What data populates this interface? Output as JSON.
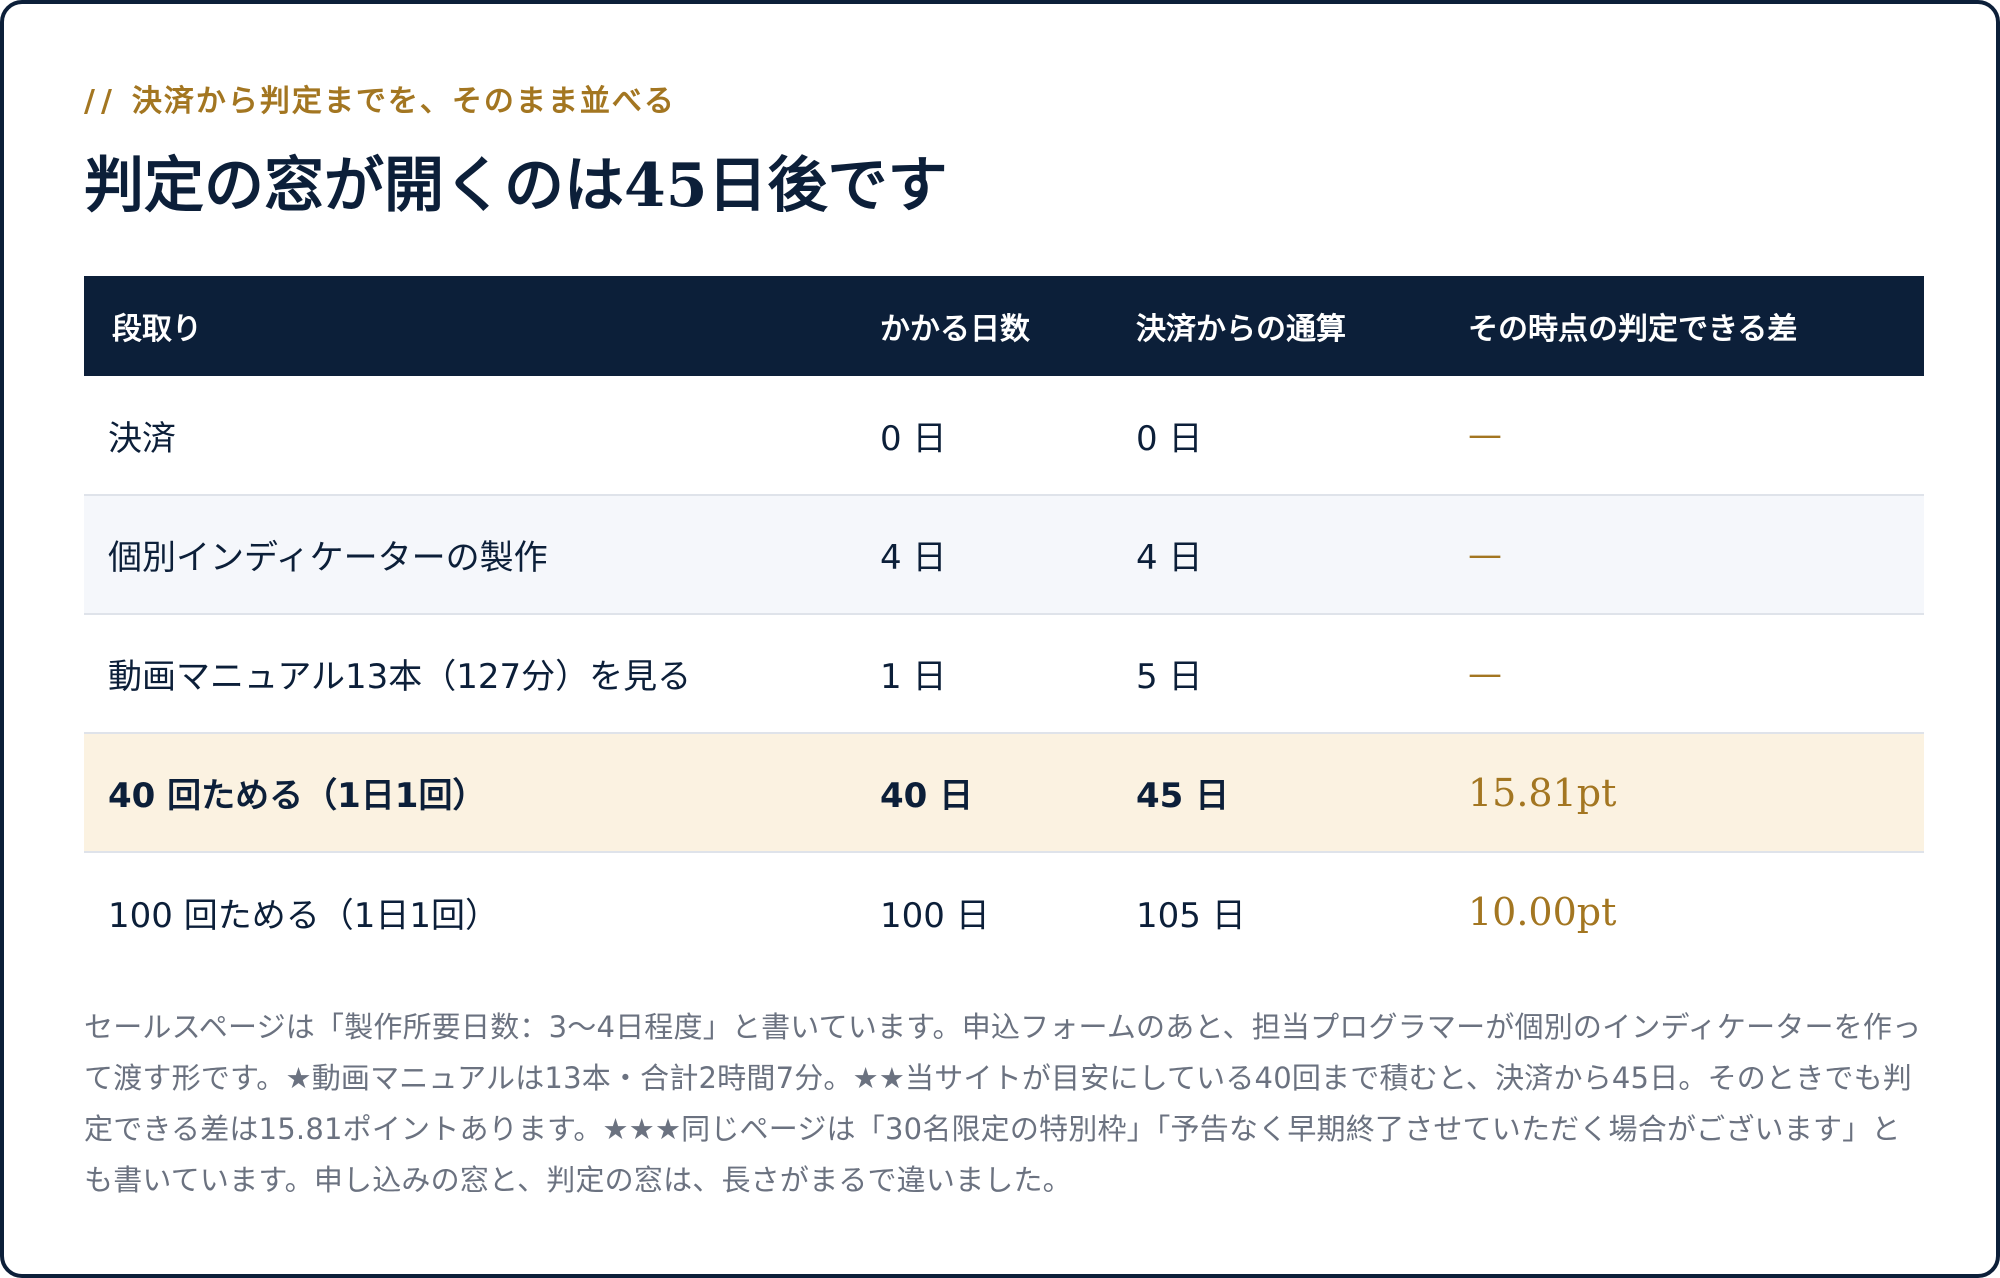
{
  "eyebrow": {
    "prefix": "//",
    "text": "決済から判定までを、そのまま並べる"
  },
  "title": "判定の窓が開くのは45日後です",
  "table": {
    "headers": [
      "段取り",
      "かかる日数",
      "決済からの通算",
      "その時点の判定できる差"
    ],
    "rows": [
      {
        "step": "決済",
        "days": "0 日",
        "cumulative": "0 日",
        "diff": "—"
      },
      {
        "step": "個別インディケーターの製作",
        "days": "4 日",
        "cumulative": "4 日",
        "diff": "—"
      },
      {
        "step": "動画マニュアル13本（127分）を見る",
        "days": "1 日",
        "cumulative": "5 日",
        "diff": "—"
      },
      {
        "step": "40 回ためる（1日1回）",
        "days": "40 日",
        "cumulative": "45 日",
        "diff": "15.81pt"
      },
      {
        "step": "100 回ためる（1日1回）",
        "days": "100 日",
        "cumulative": "105 日",
        "diff": "10.00pt"
      }
    ]
  },
  "note": "セールスページは「製作所要日数：3〜4日程度」と書いています。申込フォームのあと、担当プログラマーが個別のインディケーターを作って渡す形です。★動画マニュアルは13本・合計2時間7分。★★当サイトが目安にしている40回まで積むと、決済から45日。そのときでも判定できる差は15.81ポイントあります。★★★同じページは「30名限定の特別枠」「予告なく早期終了させていただく場合がございます」とも書いています。申し込みの窓と、判定の窓は、長さがまるで違いました。",
  "colors": {
    "navy": "#0c1f39",
    "gold": "#a37621",
    "highlight_row": "#fbf2e1",
    "alt_row": "#f5f7fb"
  }
}
